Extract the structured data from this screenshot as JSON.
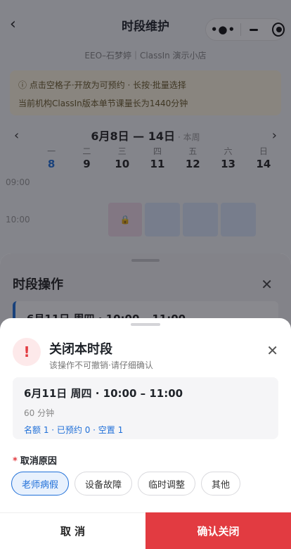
{
  "nav": {
    "title": "时段维护",
    "back_icon": "chevron-left-icon"
  },
  "capsule": {
    "more_icon": "more-dots-icon",
    "minimize_icon": "minus-icon",
    "close_icon": "target-icon"
  },
  "store": {
    "subtitle": "EEO–石梦婷｜ClassIn 演示小店"
  },
  "notice": {
    "line1": "ⓘ 点击空格子·开放为可预约 · 长按·批量选择",
    "line2": "当前机构ClassIn版本单节课量长为1440分钟"
  },
  "week": {
    "prev_icon": "chevron-left-icon",
    "next_icon": "chevron-right-icon",
    "range": "6月8日 — 14日",
    "current_tag": "· 本周",
    "days": [
      {
        "weekday": "一",
        "date": "8",
        "today": true
      },
      {
        "weekday": "二",
        "date": "9"
      },
      {
        "weekday": "三",
        "date": "10"
      },
      {
        "weekday": "四",
        "date": "11"
      },
      {
        "weekday": "五",
        "date": "12"
      },
      {
        "weekday": "六",
        "date": "13"
      },
      {
        "weekday": "日",
        "date": "14"
      }
    ],
    "times": [
      "09:00",
      "10:00"
    ]
  },
  "mid_sheet": {
    "title": "时段操作",
    "card_text": "6月11日 周四 · 10:00 – 11:00"
  },
  "dialog": {
    "title": "关闭本时段",
    "subtitle": "该操作不可撤销·请仔细确认",
    "warning_icon": "exclamation-icon",
    "close_icon": "close-icon",
    "slot": {
      "when": "6月11日 周四 · 10:00 – 11:00",
      "duration": "60 分钟",
      "stats": "名额 1 · 已预约 0 · 空置 1"
    },
    "reason_required_mark": "*",
    "reason_label": "取消原因",
    "reasons": [
      {
        "label": "老师病假",
        "selected": true
      },
      {
        "label": "设备故障",
        "selected": false
      },
      {
        "label": "临时调整",
        "selected": false
      },
      {
        "label": "其他",
        "selected": false
      }
    ],
    "cancel_label": "取 消",
    "confirm_label": "确认关闭"
  },
  "colors": {
    "accent": "#1f6fd8",
    "danger": "#e23b41",
    "notice_bg": "#fff7e0"
  }
}
